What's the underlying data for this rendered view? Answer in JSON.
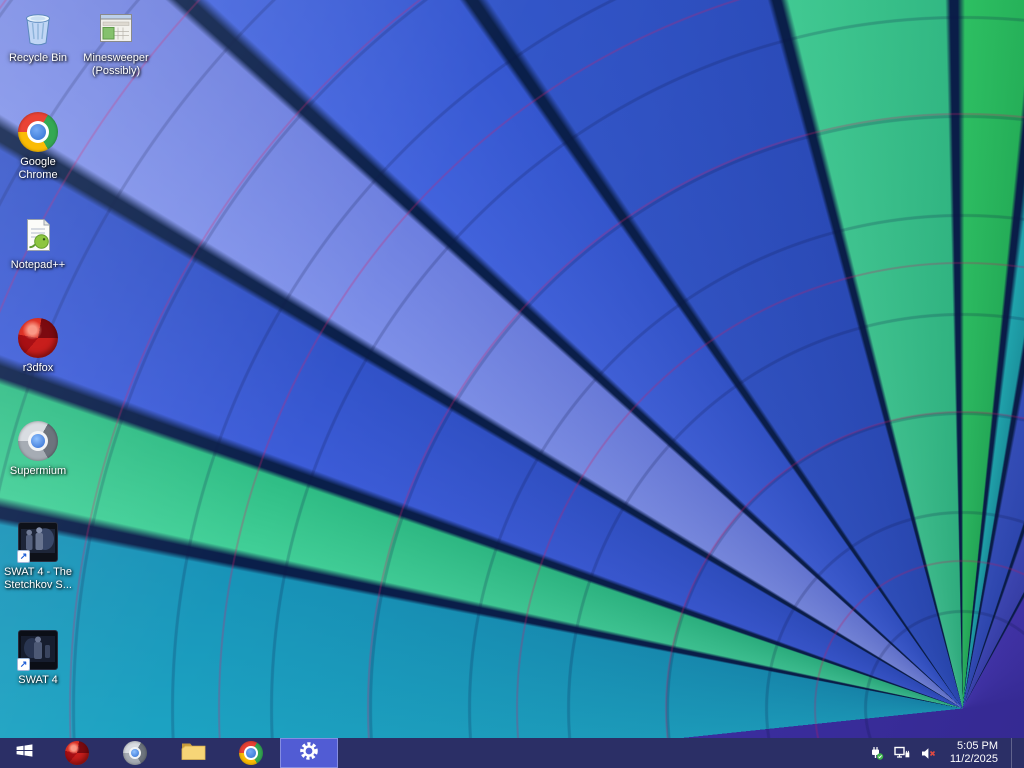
{
  "wallpaper": {
    "description": "Close-up of a multicolored hot air balloon canopy, gores radiating from lower right",
    "palette": [
      "#1ea8c6",
      "#41cf97",
      "#3c5cd8",
      "#7e90e9",
      "#4263dd",
      "#3356c9",
      "#43d196",
      "#30cd66",
      "#23b5ba",
      "#3a56c9",
      "#454fc5",
      "#4a3aba"
    ]
  },
  "desktop": {
    "icons": [
      {
        "name": "recycle-bin",
        "label": "Recycle Bin"
      },
      {
        "name": "minesweeper",
        "label": "Minesweeper (Possibly)"
      },
      {
        "name": "google-chrome",
        "label": "Google Chrome"
      },
      {
        "name": "notepad-plus-plus",
        "label": "Notepad++"
      },
      {
        "name": "r3dfox",
        "label": "r3dfox"
      },
      {
        "name": "supermium",
        "label": "Supermium"
      },
      {
        "name": "swat4-stetchkov",
        "label": "SWAT 4 - The Stetchkov S..."
      },
      {
        "name": "swat4",
        "label": "SWAT 4"
      }
    ]
  },
  "taskbar": {
    "apps": [
      "start",
      "r3dfox",
      "supermium",
      "file-explorer",
      "google-chrome",
      "settings"
    ],
    "active_app": "settings",
    "tray_icons": [
      "safely-remove-hardware",
      "network",
      "volume-muted"
    ],
    "clock": {
      "time": "5:05 PM",
      "date": "11/2/2025"
    }
  },
  "glyphs": {
    "shortcut_arrow": "↗"
  },
  "colors": {
    "taskbar_bg": "#2b2f66",
    "taskbar_active_button": "#515cd4",
    "desktop_label_text": "#ffffff"
  }
}
